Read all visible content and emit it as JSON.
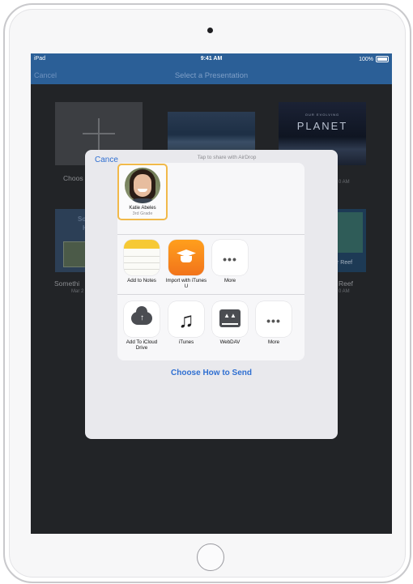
{
  "status": {
    "device": "iPad",
    "time": "9:41 AM",
    "battery": "100%"
  },
  "navbar": {
    "cancel": "Cancel",
    "title": "Select a Presentation"
  },
  "background": {
    "new_label": "Choos",
    "planet_upper": "OUR EVOLVING",
    "planet_title": "PLANET",
    "planet_time": "0 AM",
    "sound_sig": "So",
    "sound_sig2": "H",
    "sound_label": "Somethi",
    "sound_date": "Mar 2",
    "reef_label": "Reef",
    "reef_time": "0 AM",
    "reef_overlay": "r Reef"
  },
  "share_sheet": {
    "cancel": "Cance",
    "airdrop_hint": "Tap to share with AirDrop",
    "person": {
      "name": "Katie Abeles",
      "subtitle": "3rd Grade"
    },
    "row1": [
      {
        "label": "Add to Notes",
        "icon": "notes-icon"
      },
      {
        "label": "Import with iTunes U",
        "icon": "itunes-u-icon"
      },
      {
        "label": "More",
        "icon": "more-icon"
      }
    ],
    "row2": [
      {
        "label": "Add To iCloud Drive",
        "icon": "icloud-drive-icon"
      },
      {
        "label": "iTunes",
        "icon": "itunes-icon"
      },
      {
        "label": "WebDAV",
        "icon": "webdav-icon"
      },
      {
        "label": "More",
        "icon": "more-icon"
      }
    ],
    "choose_how": "Choose How to Send"
  },
  "colors": {
    "nav_bar": "#2b5f97",
    "link_blue": "#2f6fd1",
    "selection_border": "#f1b94a",
    "itunes_u_orange": "#f2741b"
  }
}
